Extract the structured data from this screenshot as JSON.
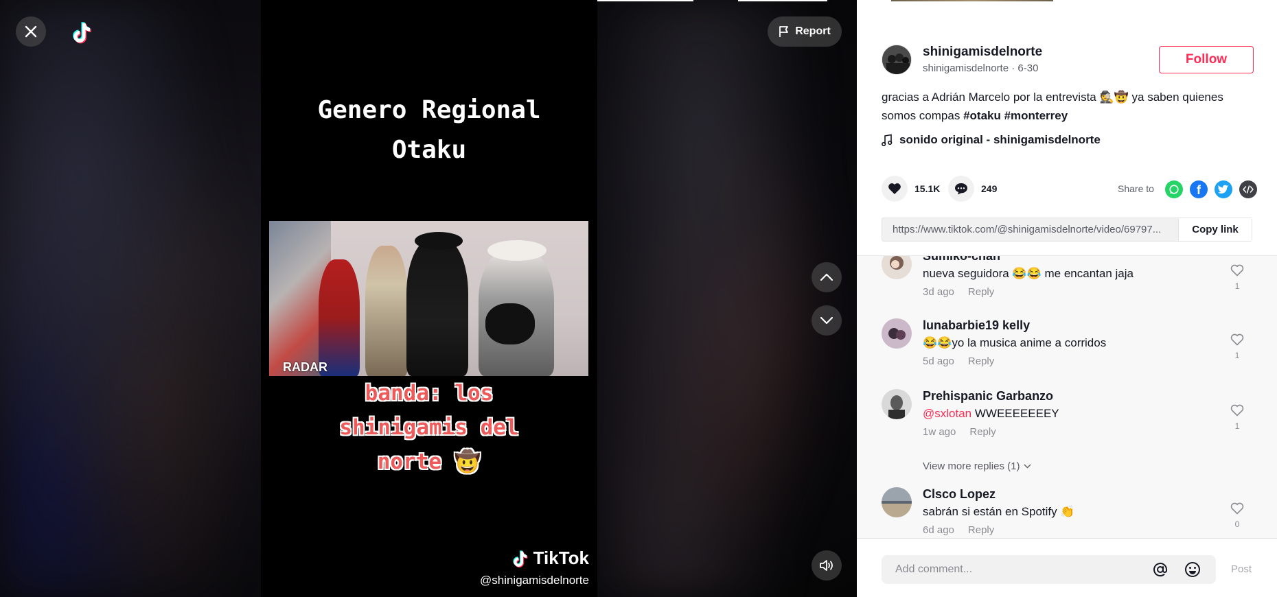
{
  "video": {
    "title_line1": "Genero Regional",
    "title_line2": "Otaku",
    "clip_label": "RADAR",
    "caption_line1": "banda: los",
    "caption_line2": "shinigamis del",
    "caption_line3": "norte 🤠",
    "watermark_brand": "TikTok",
    "watermark_user": "@shinigamisdelnorte"
  },
  "overlay": {
    "report_label": "Report",
    "icons": [
      "close-icon",
      "tiktok-logo-icon",
      "flag-icon",
      "chevron-up-icon",
      "chevron-down-icon",
      "volume-icon"
    ]
  },
  "author": {
    "name": "shinigamisdelnorte",
    "handle_date": "shinigamisdelnorte · 6-30",
    "follow_label": "Follow"
  },
  "description": {
    "text": "gracias a Adrián Marcelo por la entrevista 🕵️🤠 ya saben quienes somos compas",
    "hashtags": [
      "#otaku",
      "#monterrey"
    ]
  },
  "music": {
    "label": "sonido original - shinigamisdelnorte"
  },
  "stats": {
    "likes": "15.1K",
    "comments": "249",
    "share_label": "Share to",
    "share_targets": [
      "whatsapp-icon",
      "facebook-icon",
      "twitter-icon",
      "embed-icon"
    ]
  },
  "link": {
    "url": "https://www.tiktok.com/@shinigamisdelnorte/video/69797...",
    "copy_label": "Copy link"
  },
  "comments": [
    {
      "user": "Sumiko-chan",
      "text": "nueva seguidora 😂😂 me encantan jaja",
      "mention": "",
      "time": "3d ago",
      "reply": "Reply",
      "likes": "1"
    },
    {
      "user": "lunabarbie19 kelly",
      "text": "😂😂yo la musica anime a corridos",
      "mention": "",
      "time": "5d ago",
      "reply": "Reply",
      "likes": "1"
    },
    {
      "user": "Prehispanic Garbanzo",
      "text": " WWEEEEEEEY",
      "mention": "@sxlotan",
      "time": "1w ago",
      "reply": "Reply",
      "likes": "1"
    },
    {
      "user": "Clsco Lopez",
      "text": "sabrán si están en Spotify 👏",
      "mention": "",
      "time": "6d ago",
      "reply": "Reply",
      "likes": "0"
    }
  ],
  "view_more_replies": "View more replies (1)",
  "comment_box": {
    "placeholder": "Add comment...",
    "post_label": "Post"
  },
  "colors": {
    "accent": "#fe2c55",
    "text": "#161823",
    "muted": "#8a8b91",
    "caption_red": "#ee5a5a"
  }
}
